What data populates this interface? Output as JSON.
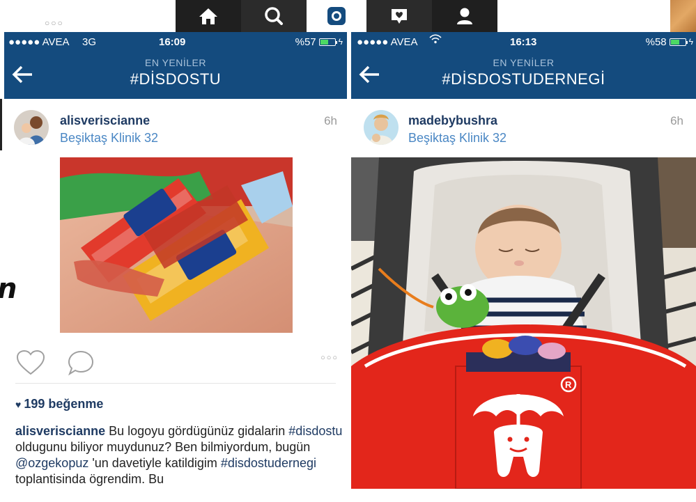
{
  "top_nav": {
    "tabs": [
      {
        "icon": "home-icon"
      },
      {
        "icon": "search-icon"
      },
      {
        "icon": "camera-icon"
      },
      {
        "icon": "activity-icon"
      },
      {
        "icon": "profile-icon"
      }
    ],
    "dots": "○○○"
  },
  "left_screen": {
    "status": {
      "carrier": "●●●●● AVEA",
      "network": "3G",
      "time": "16:09",
      "battery": "%57",
      "battery_level": 0.57
    },
    "nav": {
      "subtitle": "EN YENİLER",
      "title": "#DİSDOSTU"
    },
    "post": {
      "username": "alisveriscianne",
      "location": "Beşiktaş Klinik 32",
      "time": "6h",
      "likes": "199 beğenme",
      "more_dots": "○○○",
      "caption": {
        "user": "alisveriscianne",
        "parts": [
          {
            "t": " Bu logoyu gördügünüz gidalarin ",
            "tag": false
          },
          {
            "t": "#disdostu",
            "tag": true
          },
          {
            "t": " oldugunu biliyor muydunuz? Ben bilmiyordum, bugün ",
            "tag": false
          },
          {
            "t": "@ozgekopuz",
            "tag": true
          },
          {
            "t": " 'un davetiyle katildigim ",
            "tag": false
          },
          {
            "t": "#disdostudernegi",
            "tag": true
          },
          {
            "t": " toplantisinda ögrendim. Bu",
            "tag": false
          }
        ]
      }
    }
  },
  "right_screen": {
    "status": {
      "carrier": "●●●●● AVEA",
      "time": "16:13",
      "battery": "%58",
      "battery_level": 0.58
    },
    "nav": {
      "subtitle": "EN YENİLER",
      "title": "#DİSDOSTUDERNEGİ"
    },
    "post": {
      "username": "madebybushra",
      "location": "Beşiktaş Klinik 32",
      "time": "6h",
      "box_mark": "R"
    }
  },
  "fragment_text": "n",
  "colors": {
    "brand_blue": "#144b7e",
    "link_blue": "#1f3b63",
    "location_blue": "#4a87c4",
    "box_red": "#e3261b"
  }
}
